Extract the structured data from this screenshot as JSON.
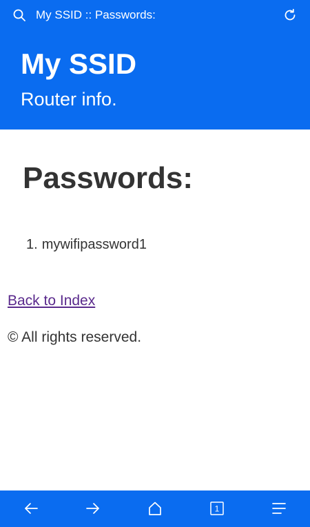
{
  "browser": {
    "title": "My SSID :: Passwords:"
  },
  "header": {
    "site_title": "My SSID",
    "subtitle": "Router info."
  },
  "content": {
    "heading": "Passwords:",
    "passwords": [
      {
        "number": "1.",
        "value": "mywifipassword1"
      }
    ],
    "back_link": "Back to Index",
    "footer": "© All rights reserved."
  },
  "nav": {
    "tab_count": "1"
  },
  "colors": {
    "brand_blue": "#0a6cf0",
    "text": "#333333",
    "link_visited": "#5a2a8c"
  }
}
